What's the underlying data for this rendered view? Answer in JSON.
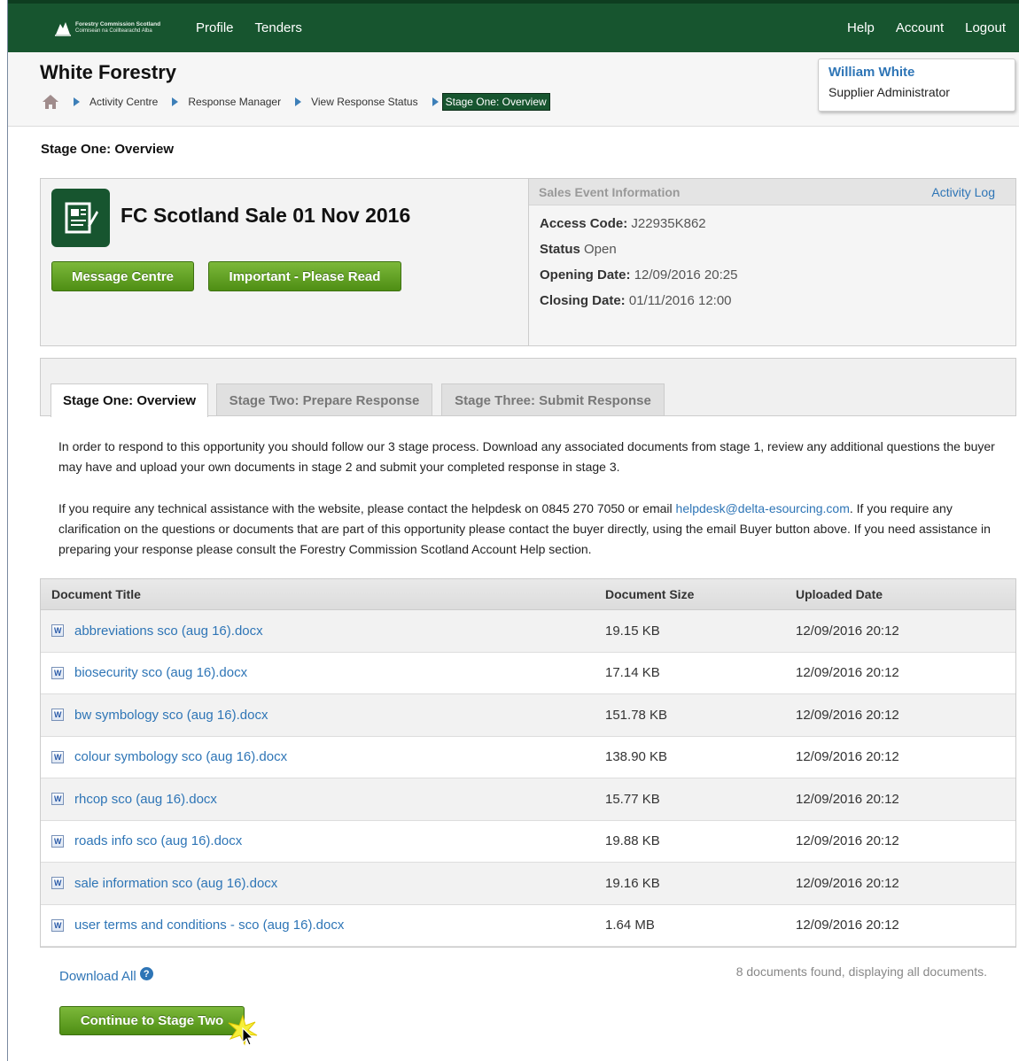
{
  "brand": {
    "logo_line1": "Forestry Commission Scotland",
    "logo_line2": "Coimisean na Coilltearachd Alba"
  },
  "topnav": {
    "left": [
      "Profile",
      "Tenders"
    ],
    "right": [
      "Help",
      "Account",
      "Logout"
    ]
  },
  "header": {
    "company": "White Forestry",
    "breadcrumb": [
      "Activity Centre",
      "Response Manager",
      "View Response Status"
    ],
    "breadcrumb_current": "Stage One: Overview",
    "user_name": "William White",
    "user_role": "Supplier Administrator"
  },
  "page_title": "Stage One: Overview",
  "event": {
    "title": "FC Scotland Sale 01 Nov 2016",
    "message_centre": "Message Centre",
    "important": "Important - Please Read",
    "info_heading": "Sales Event Information",
    "activity_log": "Activity Log",
    "access_code_label": "Access Code:",
    "access_code": "J22935K862",
    "status_label": "Status",
    "status": "Open",
    "opening_label": "Opening Date:",
    "opening": "12/09/2016 20:25",
    "closing_label": "Closing Date:",
    "closing": "01/11/2016 12:00"
  },
  "tabs": [
    "Stage One: Overview",
    "Stage Two: Prepare Response",
    "Stage Three: Submit Response"
  ],
  "intro": {
    "para1": "In order to respond to this opportunity you should follow our 3 stage process. Download any associated documents from stage 1, review any additional questions the buyer may have and upload your own documents in stage 2 and submit your completed response in stage 3.",
    "para2_before": "If you require any technical assistance with the website, please contact the helpdesk on 0845 270 7050 or email ",
    "email": "helpdesk@delta-esourcing.com",
    "para2_after": ". If you require any clarification on the questions or documents that are part of this opportunity please contact the buyer directly, using the email Buyer button above. If you need assistance in preparing your response please consult the Forestry Commission Scotland Account Help section."
  },
  "documents": {
    "headers": [
      "Document Title",
      "Document Size",
      "Uploaded Date"
    ],
    "rows": [
      {
        "title": "abbreviations sco (aug 16).docx",
        "size": "19.15 KB",
        "date": "12/09/2016 20:12"
      },
      {
        "title": "biosecurity sco (aug 16).docx",
        "size": "17.14 KB",
        "date": "12/09/2016 20:12"
      },
      {
        "title": "bw symbology sco (aug 16).docx",
        "size": "151.78 KB",
        "date": "12/09/2016 20:12"
      },
      {
        "title": "colour symbology sco (aug 16).docx",
        "size": "138.90 KB",
        "date": "12/09/2016 20:12"
      },
      {
        "title": "rhcop sco (aug 16).docx",
        "size": "15.77 KB",
        "date": "12/09/2016 20:12"
      },
      {
        "title": "roads info sco (aug 16).docx",
        "size": "19.88 KB",
        "date": "12/09/2016 20:12"
      },
      {
        "title": "sale information sco (aug 16).docx",
        "size": "19.16 KB",
        "date": "12/09/2016 20:12"
      },
      {
        "title": "user terms and conditions - sco (aug 16).docx",
        "size": "1.64 MB",
        "date": "12/09/2016 20:12"
      }
    ],
    "download_all": "Download All",
    "found": "8 documents found, displaying all documents."
  },
  "continue_button": "Continue to Stage Two",
  "colors": {
    "brand_green": "#17552f",
    "button_green": "#5c9c20",
    "link_blue": "#2e75b6"
  }
}
